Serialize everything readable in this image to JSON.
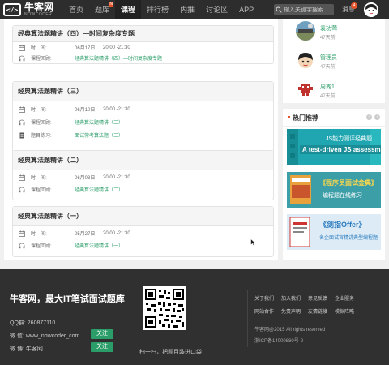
{
  "nav": {
    "logo_mark": "</>",
    "logo_name": "牛客网",
    "logo_sub": "NOWCODER",
    "items": [
      {
        "label": "首页"
      },
      {
        "label": "题库",
        "badge": "N"
      },
      {
        "label": "课程"
      },
      {
        "label": "排行榜"
      },
      {
        "label": "内推"
      },
      {
        "label": "讨论区"
      },
      {
        "label": "APP"
      }
    ],
    "search_placeholder": "输入关键字搜索",
    "messages_label": "消息",
    "messages_count": "4"
  },
  "courses": [
    {
      "title": "经典算法题精讲（四）—时间复杂度专题",
      "time_label": "时　间:",
      "date": "06月17日",
      "time": "20:00 -21:30",
      "content_label": "课程回顾:",
      "content_link": "经典算法题精讲（四）—时间复杂度专题"
    },
    {
      "title": "经典算法题精讲（三）",
      "time_label": "时　间:",
      "date": "06月10日",
      "time": "20:00 -21:30",
      "content_label": "课程回顾:",
      "content_link": "经典算法题精讲（三）",
      "practice_label": "题目练习:",
      "practice_link": "面试常考算法题（三）"
    },
    {
      "title": "经典算法题精讲（二）",
      "time_label": "时　间:",
      "date": "06月03日",
      "time": "20:00 -21:30",
      "content_label": "课程回顾:",
      "content_link": "经典算法题精讲（二）"
    },
    {
      "title": "经典算法题精讲（一）",
      "time_label": "时　间:",
      "date": "05月27日",
      "time": "20:00 -21:30",
      "content_label": "课程回顾:",
      "content_link": "经典算法题精讲（一）"
    }
  ],
  "users": [
    {
      "name": "袁功莺",
      "ago": "47天前"
    },
    {
      "name": "管理员",
      "ago": "47天前"
    },
    {
      "name": "周秀1",
      "ago": "47天前"
    }
  ],
  "recommend": {
    "title": "热门推荐",
    "banners": [
      {
        "line1": "JS能力测评经典题",
        "line2": "A test-driven JS assessment"
      },
      {
        "line1": "《程序员面试金典》",
        "line2": "编程题在线练习"
      },
      {
        "line1": "《剑指Offer》",
        "line2": "名企面试官精讲典型编程题"
      }
    ]
  },
  "footer": {
    "title": "牛客网，最大IT笔试面试题库",
    "qq": "QQ群:  260877110",
    "wechat": "微 信:  www_nowcoder_com",
    "weibo": "微 博:  牛客网",
    "follow_label": "关注",
    "qr_caption": "扫一扫，把题目装进口袋",
    "links_row1": [
      "关于我们",
      "加入我们",
      "意见反馈",
      "企业服务"
    ],
    "links_row2": [
      "网站合作",
      "免责声明",
      "友情链接",
      "模拟阵略"
    ],
    "copyright": "牛客网@2015 All rights reserved",
    "icp": "浙ICP备14000860号-2"
  }
}
